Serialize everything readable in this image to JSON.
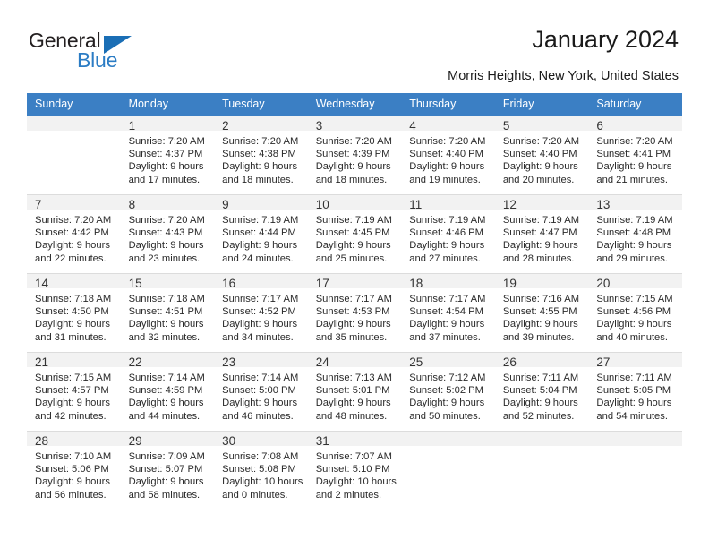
{
  "brand": {
    "name_top": "General",
    "name_bottom": "Blue",
    "accent_color": "#2b7cc4",
    "triangle_color": "#1a6eb5",
    "logo_icon": "blue-triangle-icon"
  },
  "header": {
    "title": "January 2024",
    "subtitle": "Morris Heights, New York, United States"
  },
  "calendar": {
    "header_bg": "#3b7fc4",
    "daynum_bg": "#f2f2f2",
    "weekday_headers": [
      "Sunday",
      "Monday",
      "Tuesday",
      "Wednesday",
      "Thursday",
      "Friday",
      "Saturday"
    ],
    "weeks": [
      [
        {
          "day": "",
          "sunrise": "",
          "sunset": "",
          "daylight_line1": "",
          "daylight_line2": ""
        },
        {
          "day": "1",
          "sunrise": "Sunrise: 7:20 AM",
          "sunset": "Sunset: 4:37 PM",
          "daylight_line1": "Daylight: 9 hours",
          "daylight_line2": "and 17 minutes."
        },
        {
          "day": "2",
          "sunrise": "Sunrise: 7:20 AM",
          "sunset": "Sunset: 4:38 PM",
          "daylight_line1": "Daylight: 9 hours",
          "daylight_line2": "and 18 minutes."
        },
        {
          "day": "3",
          "sunrise": "Sunrise: 7:20 AM",
          "sunset": "Sunset: 4:39 PM",
          "daylight_line1": "Daylight: 9 hours",
          "daylight_line2": "and 18 minutes."
        },
        {
          "day": "4",
          "sunrise": "Sunrise: 7:20 AM",
          "sunset": "Sunset: 4:40 PM",
          "daylight_line1": "Daylight: 9 hours",
          "daylight_line2": "and 19 minutes."
        },
        {
          "day": "5",
          "sunrise": "Sunrise: 7:20 AM",
          "sunset": "Sunset: 4:40 PM",
          "daylight_line1": "Daylight: 9 hours",
          "daylight_line2": "and 20 minutes."
        },
        {
          "day": "6",
          "sunrise": "Sunrise: 7:20 AM",
          "sunset": "Sunset: 4:41 PM",
          "daylight_line1": "Daylight: 9 hours",
          "daylight_line2": "and 21 minutes."
        }
      ],
      [
        {
          "day": "7",
          "sunrise": "Sunrise: 7:20 AM",
          "sunset": "Sunset: 4:42 PM",
          "daylight_line1": "Daylight: 9 hours",
          "daylight_line2": "and 22 minutes."
        },
        {
          "day": "8",
          "sunrise": "Sunrise: 7:20 AM",
          "sunset": "Sunset: 4:43 PM",
          "daylight_line1": "Daylight: 9 hours",
          "daylight_line2": "and 23 minutes."
        },
        {
          "day": "9",
          "sunrise": "Sunrise: 7:19 AM",
          "sunset": "Sunset: 4:44 PM",
          "daylight_line1": "Daylight: 9 hours",
          "daylight_line2": "and 24 minutes."
        },
        {
          "day": "10",
          "sunrise": "Sunrise: 7:19 AM",
          "sunset": "Sunset: 4:45 PM",
          "daylight_line1": "Daylight: 9 hours",
          "daylight_line2": "and 25 minutes."
        },
        {
          "day": "11",
          "sunrise": "Sunrise: 7:19 AM",
          "sunset": "Sunset: 4:46 PM",
          "daylight_line1": "Daylight: 9 hours",
          "daylight_line2": "and 27 minutes."
        },
        {
          "day": "12",
          "sunrise": "Sunrise: 7:19 AM",
          "sunset": "Sunset: 4:47 PM",
          "daylight_line1": "Daylight: 9 hours",
          "daylight_line2": "and 28 minutes."
        },
        {
          "day": "13",
          "sunrise": "Sunrise: 7:19 AM",
          "sunset": "Sunset: 4:48 PM",
          "daylight_line1": "Daylight: 9 hours",
          "daylight_line2": "and 29 minutes."
        }
      ],
      [
        {
          "day": "14",
          "sunrise": "Sunrise: 7:18 AM",
          "sunset": "Sunset: 4:50 PM",
          "daylight_line1": "Daylight: 9 hours",
          "daylight_line2": "and 31 minutes."
        },
        {
          "day": "15",
          "sunrise": "Sunrise: 7:18 AM",
          "sunset": "Sunset: 4:51 PM",
          "daylight_line1": "Daylight: 9 hours",
          "daylight_line2": "and 32 minutes."
        },
        {
          "day": "16",
          "sunrise": "Sunrise: 7:17 AM",
          "sunset": "Sunset: 4:52 PM",
          "daylight_line1": "Daylight: 9 hours",
          "daylight_line2": "and 34 minutes."
        },
        {
          "day": "17",
          "sunrise": "Sunrise: 7:17 AM",
          "sunset": "Sunset: 4:53 PM",
          "daylight_line1": "Daylight: 9 hours",
          "daylight_line2": "and 35 minutes."
        },
        {
          "day": "18",
          "sunrise": "Sunrise: 7:17 AM",
          "sunset": "Sunset: 4:54 PM",
          "daylight_line1": "Daylight: 9 hours",
          "daylight_line2": "and 37 minutes."
        },
        {
          "day": "19",
          "sunrise": "Sunrise: 7:16 AM",
          "sunset": "Sunset: 4:55 PM",
          "daylight_line1": "Daylight: 9 hours",
          "daylight_line2": "and 39 minutes."
        },
        {
          "day": "20",
          "sunrise": "Sunrise: 7:15 AM",
          "sunset": "Sunset: 4:56 PM",
          "daylight_line1": "Daylight: 9 hours",
          "daylight_line2": "and 40 minutes."
        }
      ],
      [
        {
          "day": "21",
          "sunrise": "Sunrise: 7:15 AM",
          "sunset": "Sunset: 4:57 PM",
          "daylight_line1": "Daylight: 9 hours",
          "daylight_line2": "and 42 minutes."
        },
        {
          "day": "22",
          "sunrise": "Sunrise: 7:14 AM",
          "sunset": "Sunset: 4:59 PM",
          "daylight_line1": "Daylight: 9 hours",
          "daylight_line2": "and 44 minutes."
        },
        {
          "day": "23",
          "sunrise": "Sunrise: 7:14 AM",
          "sunset": "Sunset: 5:00 PM",
          "daylight_line1": "Daylight: 9 hours",
          "daylight_line2": "and 46 minutes."
        },
        {
          "day": "24",
          "sunrise": "Sunrise: 7:13 AM",
          "sunset": "Sunset: 5:01 PM",
          "daylight_line1": "Daylight: 9 hours",
          "daylight_line2": "and 48 minutes."
        },
        {
          "day": "25",
          "sunrise": "Sunrise: 7:12 AM",
          "sunset": "Sunset: 5:02 PM",
          "daylight_line1": "Daylight: 9 hours",
          "daylight_line2": "and 50 minutes."
        },
        {
          "day": "26",
          "sunrise": "Sunrise: 7:11 AM",
          "sunset": "Sunset: 5:04 PM",
          "daylight_line1": "Daylight: 9 hours",
          "daylight_line2": "and 52 minutes."
        },
        {
          "day": "27",
          "sunrise": "Sunrise: 7:11 AM",
          "sunset": "Sunset: 5:05 PM",
          "daylight_line1": "Daylight: 9 hours",
          "daylight_line2": "and 54 minutes."
        }
      ],
      [
        {
          "day": "28",
          "sunrise": "Sunrise: 7:10 AM",
          "sunset": "Sunset: 5:06 PM",
          "daylight_line1": "Daylight: 9 hours",
          "daylight_line2": "and 56 minutes."
        },
        {
          "day": "29",
          "sunrise": "Sunrise: 7:09 AM",
          "sunset": "Sunset: 5:07 PM",
          "daylight_line1": "Daylight: 9 hours",
          "daylight_line2": "and 58 minutes."
        },
        {
          "day": "30",
          "sunrise": "Sunrise: 7:08 AM",
          "sunset": "Sunset: 5:08 PM",
          "daylight_line1": "Daylight: 10 hours",
          "daylight_line2": "and 0 minutes."
        },
        {
          "day": "31",
          "sunrise": "Sunrise: 7:07 AM",
          "sunset": "Sunset: 5:10 PM",
          "daylight_line1": "Daylight: 10 hours",
          "daylight_line2": "and 2 minutes."
        },
        {
          "day": "",
          "sunrise": "",
          "sunset": "",
          "daylight_line1": "",
          "daylight_line2": ""
        },
        {
          "day": "",
          "sunrise": "",
          "sunset": "",
          "daylight_line1": "",
          "daylight_line2": ""
        },
        {
          "day": "",
          "sunrise": "",
          "sunset": "",
          "daylight_line1": "",
          "daylight_line2": ""
        }
      ]
    ]
  }
}
